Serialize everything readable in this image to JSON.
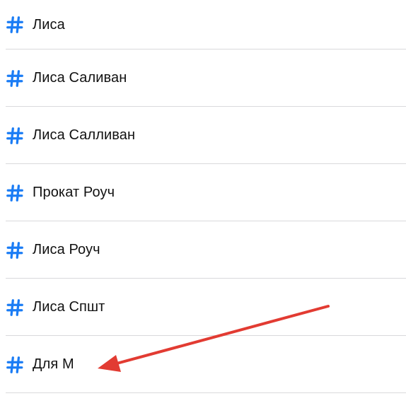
{
  "accent_color": "#1a7cf5",
  "annotation_color": "#e23b32",
  "hashtag_list": {
    "items": [
      {
        "icon": "hashtag-icon",
        "label": "Лиса"
      },
      {
        "icon": "hashtag-icon",
        "label": "Лиса Саливан"
      },
      {
        "icon": "hashtag-icon",
        "label": "Лиса Салливан"
      },
      {
        "icon": "hashtag-icon",
        "label": "Прокат Роуч"
      },
      {
        "icon": "hashtag-icon",
        "label": "Лиса Роуч"
      },
      {
        "icon": "hashtag-icon",
        "label": "Лиса Спшт"
      },
      {
        "icon": "hashtag-icon",
        "label": "Для М"
      }
    ]
  },
  "annotation": {
    "type": "arrow",
    "points_to_item": 6
  }
}
